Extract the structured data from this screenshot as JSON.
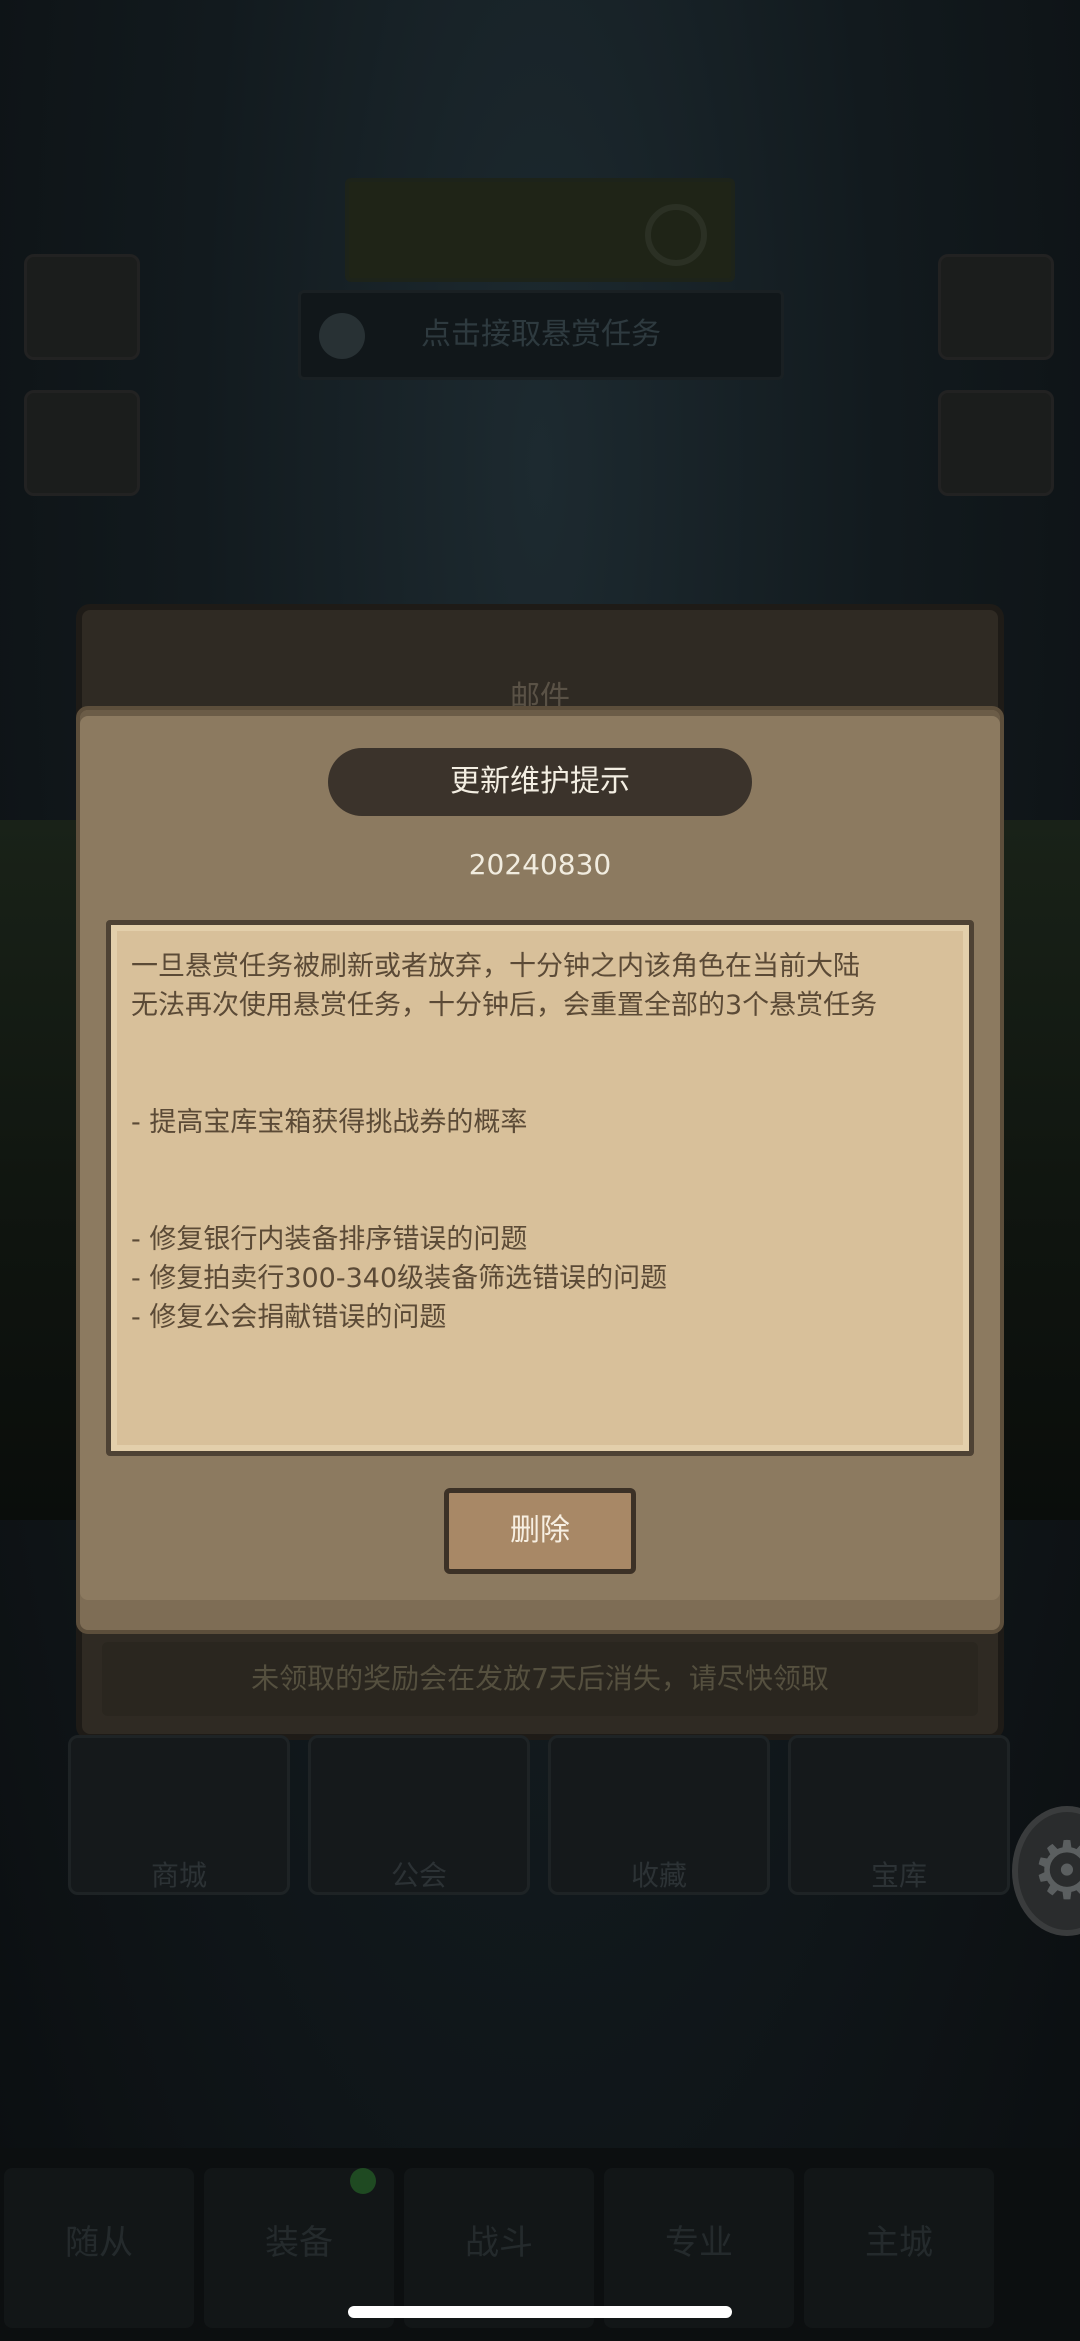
{
  "background": {
    "quest_box": {
      "line1": "",
      "line2": ""
    },
    "bounty_bar": "点击接取悬赏任务",
    "left_icons": [],
    "right_icons": [],
    "cards": [
      "商城",
      "公会",
      "收藏",
      "宝库"
    ],
    "tabs": [
      "随从",
      "装备",
      "战斗",
      "专业",
      "主城"
    ]
  },
  "mail": {
    "title": "邮件",
    "footer": "未领取的奖励会在发放7天后消失，请尽快领取"
  },
  "dialog": {
    "title": "更新维护提示",
    "date": "20240830",
    "body": "一旦悬赏任务被刷新或者放弃，十分钟之内该角色在当前大陆\n无法再次使用悬赏任务，十分钟后，会重置全部的3个悬赏任务\n\n\n- 提高宝库宝箱获得挑战券的概率\n\n\n- 修复银行内装备排序错误的问题\n- 修复拍卖行300-340级装备筛选错误的问题\n- 修复公会捐献错误的问题",
    "delete_label": "删除"
  }
}
